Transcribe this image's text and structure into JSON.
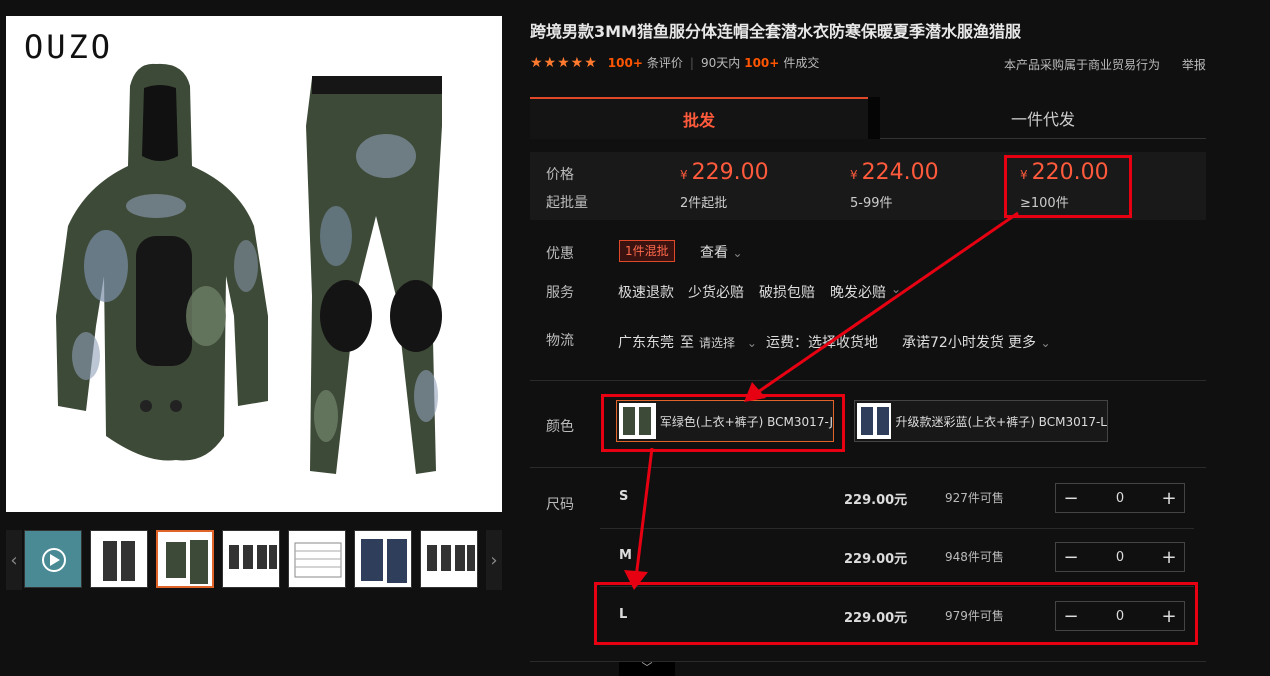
{
  "product": {
    "brand_logo": "OUZO",
    "title": "跨境男款3MM猎鱼服分体连帽全套潜水衣防寒保暖夏季潜水服渔猎服",
    "stars": "★★★★★",
    "review_count": "100+",
    "review_label": "条评价",
    "deal_period": "90天内",
    "deal_count": "100+",
    "deal_label": "件成交",
    "purchase_notice": "本产品采购属于商业贸易行为",
    "report_label": "举报"
  },
  "tabs": {
    "wholesale": "批发",
    "dropship": "一件代发"
  },
  "pricing": {
    "price_label": "价格",
    "moq_label": "起批量",
    "currency": "¥",
    "tiers": [
      {
        "price": "229.00",
        "moq": "2件起批"
      },
      {
        "price": "224.00",
        "moq": "5-99件"
      },
      {
        "price": "220.00",
        "moq": "≥100件"
      }
    ]
  },
  "promo": {
    "label": "优惠",
    "badge": "1件混批",
    "view": "查看"
  },
  "service": {
    "label": "服务",
    "items": [
      "极速退款",
      "少货必赔",
      "破损包赔",
      "晚发必赔"
    ]
  },
  "logistics": {
    "label": "物流",
    "origin": "广东东莞",
    "to": "至",
    "select": "请选择",
    "freight": "运费：选择收货地",
    "promise": "承诺72小时发货",
    "more": "更多"
  },
  "color": {
    "label": "颜色",
    "options": [
      {
        "name": "军绿色(上衣+裤子) BCM3017-J",
        "selected": true
      },
      {
        "name": "升级款迷彩蓝(上衣+裤子) BCM3017-L",
        "selected": false
      }
    ]
  },
  "sizes": {
    "label": "尺码",
    "rows": [
      {
        "size": "S",
        "price": "229.00元",
        "stock": "927件可售",
        "qty": "0"
      },
      {
        "size": "M",
        "price": "229.00元",
        "stock": "948件可售",
        "qty": "0"
      },
      {
        "size": "L",
        "price": "229.00元",
        "stock": "979件可售",
        "qty": "0"
      }
    ]
  },
  "stepper": {
    "minus": "−",
    "plus": "+"
  },
  "nav": {
    "prev": "‹",
    "next": "›",
    "expand": "﹀"
  },
  "colors": {
    "accent": "#ff5a3c",
    "annotation": "#e60012",
    "star": "#ff7a2e",
    "background": "#101010"
  }
}
